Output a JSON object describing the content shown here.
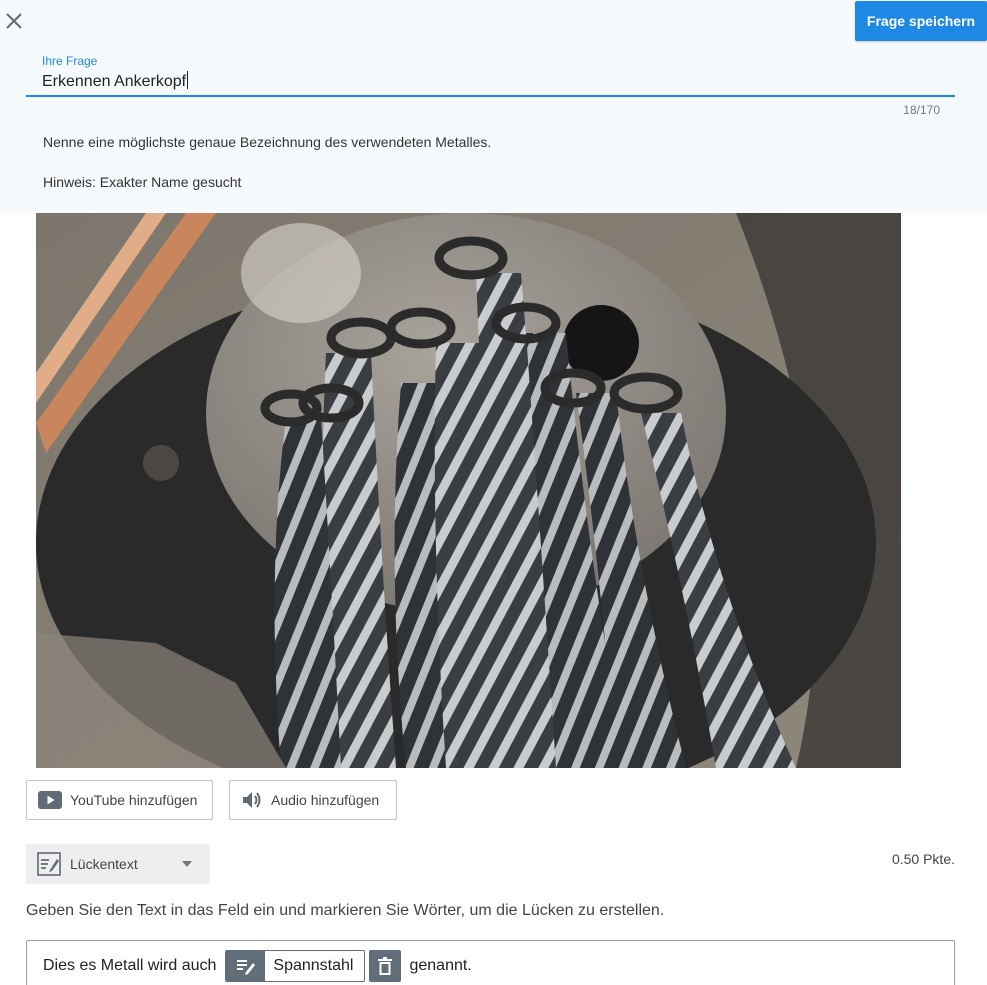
{
  "header": {
    "close_icon": "close-icon",
    "save_label": "Frage speichern",
    "accent_color": "#1e88e5"
  },
  "question": {
    "label": "Ihre Frage",
    "value": "Erkennen Ankerkopf",
    "counter": "18/170",
    "description": "Nenne eine möglichste genaue Bezeichnung des verwendeten Metalles.",
    "hint": "Hinweis: Exakter Name gesucht"
  },
  "media": {
    "image_icon": "photo-anchor-head-strands",
    "youtube_label": "YouTube hinzufügen",
    "youtube_icon": "youtube-icon",
    "audio_label": "Audio hinzufügen",
    "audio_icon": "speaker-icon"
  },
  "answer": {
    "type_label": "Lückentext",
    "type_icon": "edit-note-icon",
    "points": "0.50 Pkte.",
    "instruction": "Geben Sie den Text in das Feld ein und markieren Sie Wörter, um die Lücken zu erstellen.",
    "text_before": "Dies es Metall wird auch",
    "gap_word": "Spannstahl",
    "text_after": "genannt."
  }
}
